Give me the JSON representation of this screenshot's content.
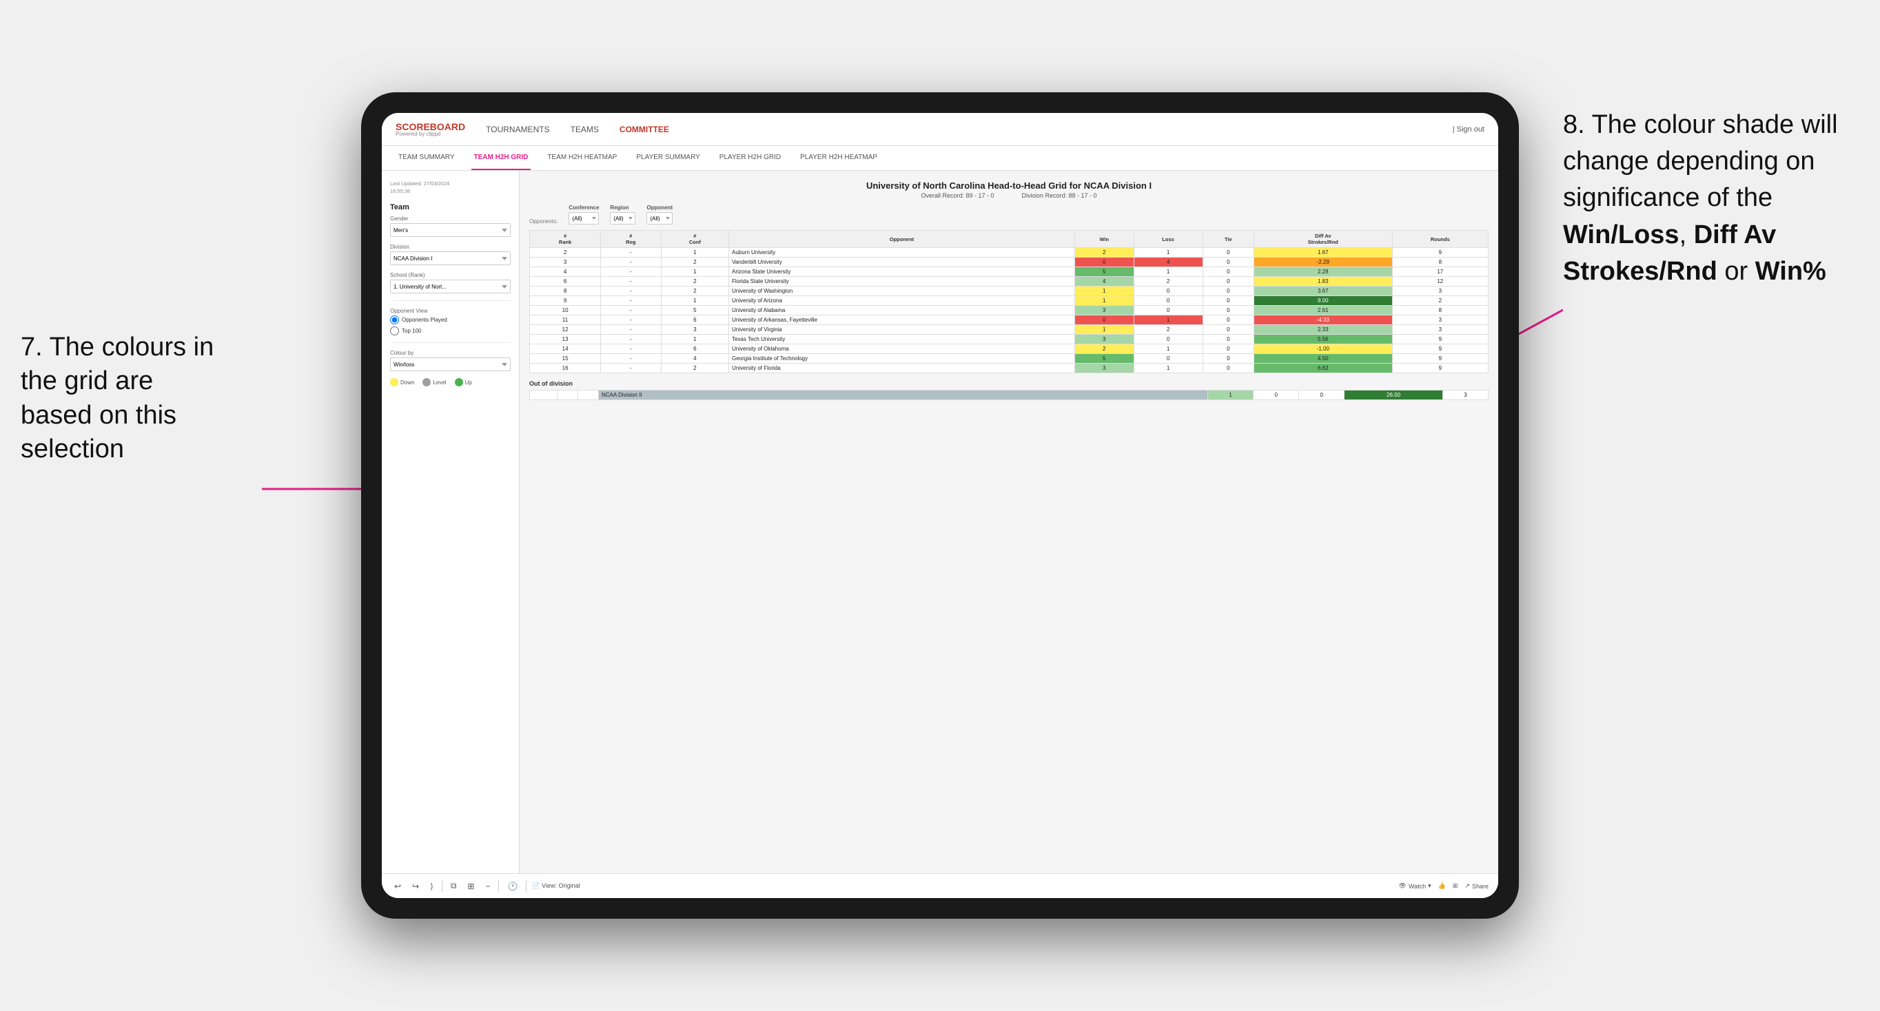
{
  "page": {
    "background": "#f0f0f0"
  },
  "annotation_left": {
    "text": "7. The colours in the grid are based on this selection"
  },
  "annotation_right": {
    "line1": "8. The colour shade will change depending on significance of the ",
    "bold1": "Win/Loss",
    "line2": ", ",
    "bold2": "Diff Av Strokes/Rnd",
    "line3": " or ",
    "bold3": "Win%"
  },
  "nav": {
    "logo": "SCOREBOARD",
    "logo_sub": "Powered by clippd",
    "items": [
      "TOURNAMENTS",
      "TEAMS",
      "COMMITTEE"
    ],
    "active": "COMMITTEE",
    "sign_out": "Sign out"
  },
  "sub_nav": {
    "items": [
      "TEAM SUMMARY",
      "TEAM H2H GRID",
      "TEAM H2H HEATMAP",
      "PLAYER SUMMARY",
      "PLAYER H2H GRID",
      "PLAYER H2H HEATMAP"
    ],
    "active": "TEAM H2H GRID"
  },
  "sidebar": {
    "last_updated_label": "Last Updated: 27/03/2024",
    "last_updated_time": "16:55:38",
    "team_section": "Team",
    "gender_label": "Gender",
    "gender_value": "Men's",
    "division_label": "Division",
    "division_value": "NCAA Division I",
    "school_label": "School (Rank)",
    "school_value": "1. University of Nort...",
    "opponent_view_label": "Opponent View",
    "radio1": "Opponents Played",
    "radio2": "Top 100",
    "colour_by_label": "Colour by",
    "colour_by_value": "Win/loss",
    "legend_down": "Down",
    "legend_level": "Level",
    "legend_up": "Up"
  },
  "grid": {
    "title": "University of North Carolina Head-to-Head Grid for NCAA Division I",
    "overall_record": "Overall Record: 89 - 17 - 0",
    "division_record": "Division Record: 88 - 17 - 0",
    "filters": {
      "conference_label": "Conference",
      "conference_value": "(All)",
      "region_label": "Region",
      "region_value": "(All)",
      "opponent_label": "Opponent",
      "opponent_value": "(All)",
      "opponents_label": "Opponents:"
    },
    "columns": [
      "#\nRank",
      "#\nReg",
      "#\nConf",
      "Opponent",
      "Win",
      "Loss",
      "Tie",
      "Diff Av\nStrokes/Rnd",
      "Rounds"
    ],
    "rows": [
      {
        "rank": "2",
        "reg": "-",
        "conf": "1",
        "opponent": "Auburn University",
        "win": "2",
        "loss": "1",
        "tie": "0",
        "diff": "1.67",
        "rounds": "9",
        "win_color": "yellow",
        "loss_color": "white",
        "diff_color": "yellow"
      },
      {
        "rank": "3",
        "reg": "-",
        "conf": "2",
        "opponent": "Vanderbilt University",
        "win": "0",
        "loss": "4",
        "tie": "0",
        "diff": "-2.29",
        "rounds": "8",
        "win_color": "red",
        "loss_color": "red",
        "diff_color": "orange"
      },
      {
        "rank": "4",
        "reg": "-",
        "conf": "1",
        "opponent": "Arizona State University",
        "win": "5",
        "loss": "1",
        "tie": "0",
        "diff": "2.28",
        "rounds": "17",
        "win_color": "green_med",
        "loss_color": "white",
        "diff_color": "green_light"
      },
      {
        "rank": "6",
        "reg": "-",
        "conf": "2",
        "opponent": "Florida State University",
        "win": "4",
        "loss": "2",
        "tie": "0",
        "diff": "1.83",
        "rounds": "12",
        "win_color": "green_light",
        "loss_color": "white",
        "diff_color": "yellow"
      },
      {
        "rank": "8",
        "reg": "-",
        "conf": "2",
        "opponent": "University of Washington",
        "win": "1",
        "loss": "0",
        "tie": "0",
        "diff": "3.67",
        "rounds": "3",
        "win_color": "yellow",
        "loss_color": "white",
        "diff_color": "green_light"
      },
      {
        "rank": "9",
        "reg": "-",
        "conf": "1",
        "opponent": "University of Arizona",
        "win": "1",
        "loss": "0",
        "tie": "0",
        "diff": "9.00",
        "rounds": "2",
        "win_color": "yellow",
        "loss_color": "white",
        "diff_color": "green_dark"
      },
      {
        "rank": "10",
        "reg": "-",
        "conf": "5",
        "opponent": "University of Alabama",
        "win": "3",
        "loss": "0",
        "tie": "0",
        "diff": "2.61",
        "rounds": "8",
        "win_color": "green_light",
        "loss_color": "white",
        "diff_color": "green_light"
      },
      {
        "rank": "11",
        "reg": "-",
        "conf": "6",
        "opponent": "University of Arkansas, Fayetteville",
        "win": "0",
        "loss": "1",
        "tie": "0",
        "diff": "-4.33",
        "rounds": "3",
        "win_color": "red",
        "loss_color": "red",
        "diff_color": "red"
      },
      {
        "rank": "12",
        "reg": "-",
        "conf": "3",
        "opponent": "University of Virginia",
        "win": "1",
        "loss": "2",
        "tie": "0",
        "diff": "2.33",
        "rounds": "3",
        "win_color": "yellow",
        "loss_color": "white",
        "diff_color": "green_light"
      },
      {
        "rank": "13",
        "reg": "-",
        "conf": "1",
        "opponent": "Texas Tech University",
        "win": "3",
        "loss": "0",
        "tie": "0",
        "diff": "5.56",
        "rounds": "9",
        "win_color": "green_light",
        "loss_color": "white",
        "diff_color": "green_med"
      },
      {
        "rank": "14",
        "reg": "-",
        "conf": "6",
        "opponent": "University of Oklahoma",
        "win": "2",
        "loss": "1",
        "tie": "0",
        "diff": "-1.00",
        "rounds": "9",
        "win_color": "yellow",
        "loss_color": "white",
        "diff_color": "yellow"
      },
      {
        "rank": "15",
        "reg": "-",
        "conf": "4",
        "opponent": "Georgia Institute of Technology",
        "win": "5",
        "loss": "0",
        "tie": "0",
        "diff": "4.50",
        "rounds": "9",
        "win_color": "green_med",
        "loss_color": "white",
        "diff_color": "green_med"
      },
      {
        "rank": "16",
        "reg": "-",
        "conf": "2",
        "opponent": "University of Florida",
        "win": "3",
        "loss": "1",
        "tie": "0",
        "diff": "6.62",
        "rounds": "9",
        "win_color": "green_light",
        "loss_color": "white",
        "diff_color": "green_med"
      }
    ],
    "out_of_division_label": "Out of division",
    "out_of_division_row": {
      "division": "NCAA Division II",
      "win": "1",
      "loss": "0",
      "tie": "0",
      "diff": "26.00",
      "rounds": "3",
      "diff_color": "green_dark"
    }
  },
  "toolbar": {
    "view_label": "View: Original",
    "watch_label": "Watch",
    "share_label": "Share"
  }
}
